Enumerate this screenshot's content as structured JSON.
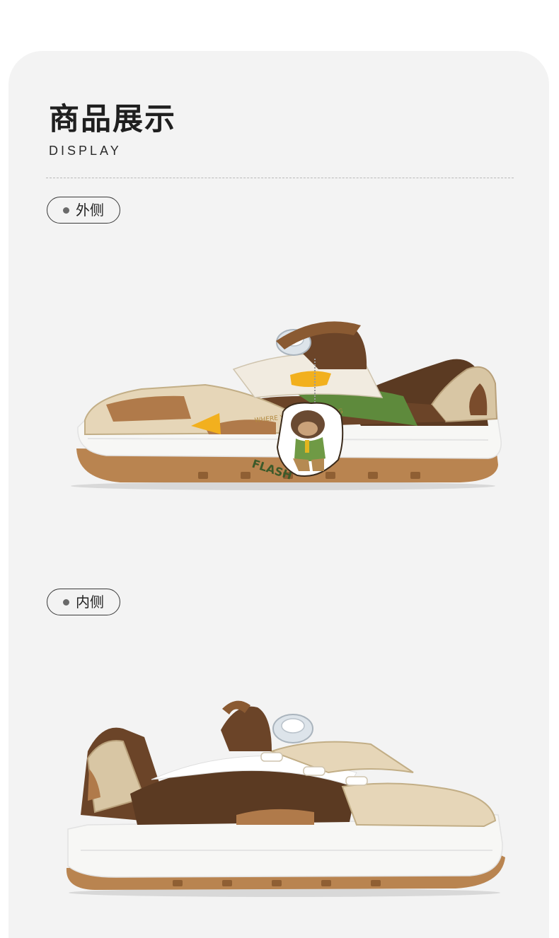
{
  "header": {
    "title": "商品展示",
    "subtitle": "DISPLAY"
  },
  "sections": [
    {
      "label": "外侧"
    },
    {
      "label": "内侧"
    }
  ],
  "shoe_print": {
    "brand_text": "FLASH",
    "tongue_text": "WHERE YOU ARE ANYTHING"
  },
  "colors": {
    "panel": "#f3f3f3",
    "dark_brown": "#5b3a22",
    "tan": "#d8c6a4",
    "light_tan": "#e6d6b8",
    "caramel": "#b07a4a",
    "green": "#5e8a3c",
    "yellow": "#f2b01e",
    "sole_white": "#f7f7f5",
    "gum": "#b98450"
  }
}
